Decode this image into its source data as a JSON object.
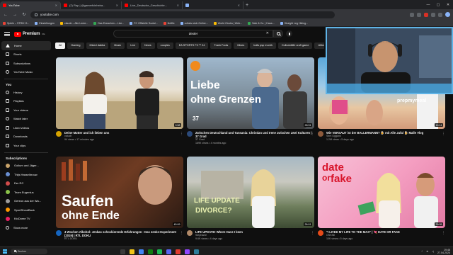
{
  "browser": {
    "tabs": [
      {
        "label": "YouTube",
        "active": true
      },
      {
        "label": "(2) Rap | @gamerfcinheira...",
        "active": false
      },
      {
        "label": "Live_Deutsche_Geschichte...",
        "active": false
      },
      {
        "label": "",
        "active": false
      }
    ],
    "url": "youtube.com",
    "bookmarks": [
      "Spiele – STRIX G...",
      "Einstellungen",
      "claude – Alle Leute...",
      "Das Erwachen – Live...",
      "FC Offizielle Sozial...",
      "Netflix",
      "collabz.club Online...",
      "World Clocks | Web...",
      "Sale & Co. | Haus...",
      "Straight Leg Hiking...",
      "Moonfolk Time",
      "OLDSKOOL HOME B...",
      "Alle Lesezeichen"
    ]
  },
  "header": {
    "logo_text": "Premium",
    "logo_sup": "DE",
    "search_value": "dexter"
  },
  "sidebar": {
    "main": [
      {
        "label": "Home",
        "icon": "home-icon",
        "active": true
      },
      {
        "label": "Shorts",
        "icon": "shorts-icon"
      },
      {
        "label": "Subscriptions",
        "icon": "subscriptions-icon"
      },
      {
        "label": "YouTube Music",
        "icon": "music-icon"
      }
    ],
    "you_title": "You",
    "you": [
      {
        "label": "History",
        "icon": "history-icon"
      },
      {
        "label": "Playlists",
        "icon": "playlists-icon"
      },
      {
        "label": "Your videos",
        "icon": "your-videos-icon"
      },
      {
        "label": "Watch later",
        "icon": "watch-later-icon"
      },
      {
        "label": "Liked videos",
        "icon": "liked-icon"
      },
      {
        "label": "Downloads",
        "icon": "downloads-icon"
      },
      {
        "label": "Your clips",
        "icon": "clips-icon"
      }
    ],
    "subs_title": "Subscriptions",
    "subscriptions": [
      {
        "label": "Gollum und Jäger...",
        "color": "#c9a46b"
      },
      {
        "label": "Thijs Hasselbrouw",
        "color": "#6a8fd1"
      },
      {
        "label": "Der RC",
        "color": "#d14b4b"
      },
      {
        "label": "Team Eugenius",
        "color": "#8bc34a"
      },
      {
        "label": "Gereon aus der Wa...",
        "color": "#9e9e9e"
      },
      {
        "label": "SportShoutBack",
        "color": "#ff9800"
      },
      {
        "label": "KioDome TV",
        "color": "#e91e63"
      },
      {
        "label": "Show more",
        "color": ""
      }
    ]
  },
  "chips": [
    "All",
    "Gaming",
    "Mixed dabba",
    "Music",
    "Live",
    "News",
    "couples",
    "EA SPORTS FC™ 24",
    "Trash Fools",
    "Mixes",
    "bulls psp month",
    "Culture&life craft game",
    "Ultimate Miami"
  ],
  "videos": [
    {
      "title": "Deine Mutter und ich lieben uns",
      "channel": "vaiuch",
      "stats": "94 views • 17 minutes ago",
      "duration": "0:58",
      "avatar": "#d6a300"
    },
    {
      "title": "Zwischen Deutschland und Tansania: Christian und Irene zwischen zwei Kulturen | 37 Grad",
      "channel": "37 Grad",
      "stats": "169K views • 4 months ago",
      "duration": "28:31",
      "avatar": "#2c4a7a"
    },
    {
      "title": "Wie VERSAUT ist der BALLERMANN? 🍺 mit Alle Jufal 🍺 Malle Vlog",
      "channel": "Sem Uggans",
      "stats": "1.2M views • 5 days ago",
      "duration": "16:14",
      "avatar": "#8d5a3b"
    },
    {
      "title": "4 Wochen Alkohol: Jenkas schockierende Erfahrungen - Das Jenke-Experiment (2019) | RTL DOKU",
      "channel": "RTL DOKU",
      "stats": "",
      "duration": "45:09",
      "avatar": "#1565c0"
    },
    {
      "title": "LIFE UPDATE! Where Have I been",
      "channel": "Stephanie",
      "stats": "9.6K views • 4 days ago",
      "duration": "26:01",
      "avatar": "#b08968"
    },
    {
      "title": "\"I LIVED MY LIFE TO THE MAX\" | 💘 DATE OR FAKE",
      "channel": "OSKINI",
      "stats": "10K views • 5 days ago",
      "duration": "39:05",
      "avatar": "#e64a19"
    }
  ],
  "thumb_text": {
    "v2_line1": "Liebe",
    "v2_line2": "ohne Grenzen",
    "v2_badge": "37",
    "v3_brand": "prepmymeal",
    "v4_line1": "Saufen",
    "v4_line2": "ohne Ende",
    "v5_text": "LIFE UPDATE",
    "v5_sub": "DIVORCE?",
    "v6_line1": "date",
    "v6_line2": "or",
    "v6_line3": "fake"
  },
  "taskbar": {
    "search": "Suchen",
    "time": "19:48",
    "date": "27.04.2024"
  }
}
